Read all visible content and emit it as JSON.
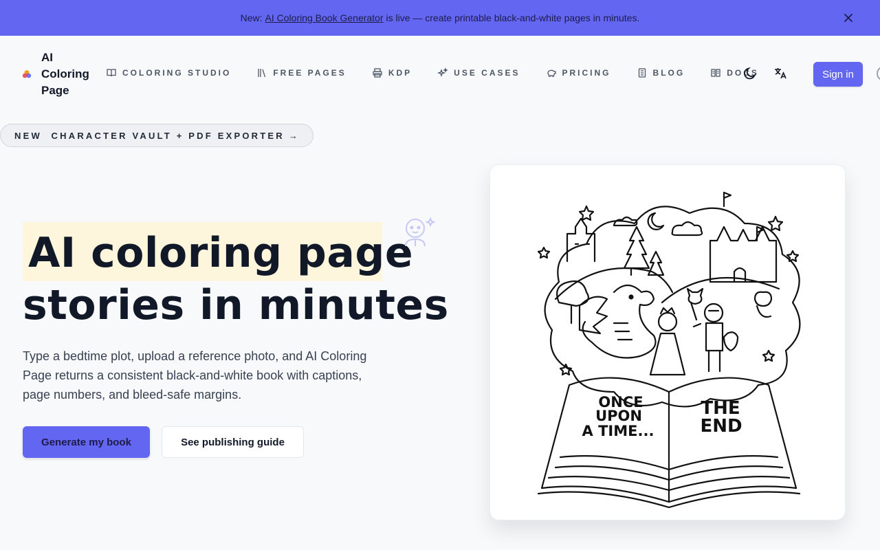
{
  "banner": {
    "prefix": "New:",
    "link": "AI Coloring Book Generator",
    "suffix": "is live — create printable black-and-white pages in minutes.",
    "close_icon": "close-icon"
  },
  "brand": {
    "name_line1": "AI",
    "name_line2": "Coloring",
    "name_line3": "Page",
    "accent": "#6366f1"
  },
  "nav": {
    "items": [
      {
        "label": "COLORING STUDIO",
        "icon": "book-open-icon"
      },
      {
        "label": "FREE PAGES",
        "icon": "library-icon"
      },
      {
        "label": "KDP",
        "icon": "printer-icon"
      },
      {
        "label": "USE CASES",
        "icon": "sparkles-icon"
      },
      {
        "label": "PRICING",
        "icon": "piggy-bank-icon"
      },
      {
        "label": "BLOG",
        "icon": "notebook-icon"
      },
      {
        "label": "DOCS",
        "icon": "book-icon"
      }
    ],
    "theme_icon": "moon-icon",
    "language_icon": "translate-icon",
    "sign_in": "Sign in"
  },
  "pill": {
    "label": "NEW  CHARACTER VAULT + PDF EXPORTER",
    "arrow": "→"
  },
  "hero": {
    "title_line1": "AI coloring page",
    "title_line2": "stories in minutes",
    "description": "Type a bedtime plot, upload a reference photo, and AI Coloring Page returns a consistent black-and-white book with captions, page numbers, and bleed-safe margins.",
    "primary_cta": "Generate my book",
    "secondary_cta": "See publishing guide",
    "highlight_color": "#fdf6dc"
  },
  "illustration": {
    "left_page_line1": "ONCE",
    "left_page_line2": "UPON",
    "left_page_line3": "A TIME...",
    "right_page_line1": "THE",
    "right_page_line2": "END"
  }
}
